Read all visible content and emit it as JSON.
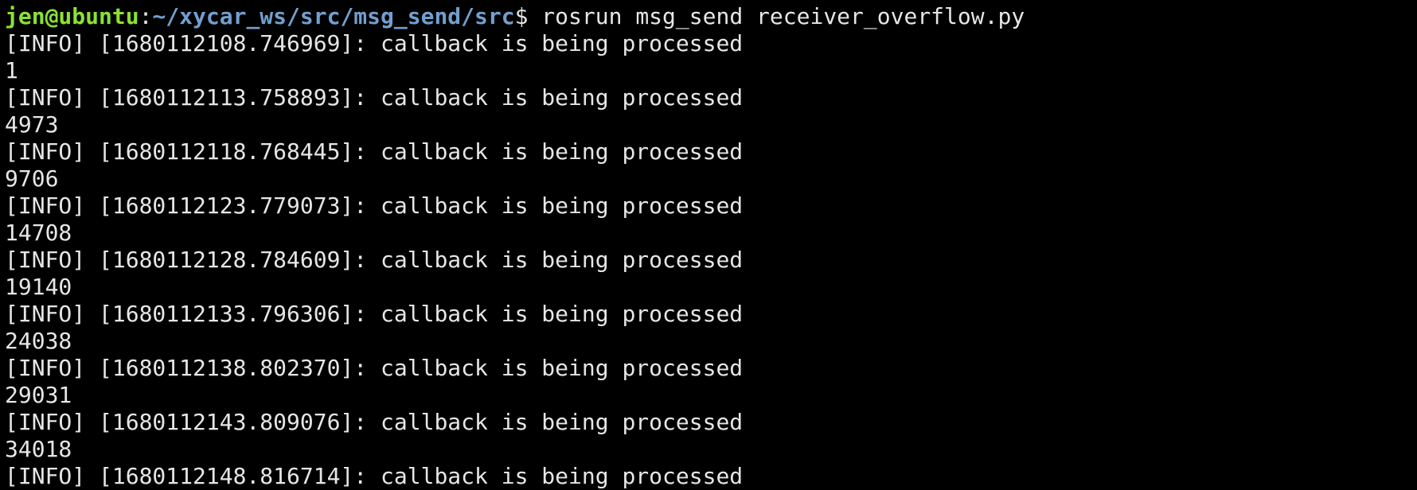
{
  "terminal": {
    "prompt": {
      "user_host": "jen@ubuntu",
      "separator": ":",
      "path": "~/xycar_ws/src/msg_send/src",
      "symbol": "$",
      "command": " rosrun msg_send receiver_overflow.py"
    },
    "output": [
      "[INFO] [1680112108.746969]: callback is being processed",
      "1",
      "[INFO] [1680112113.758893]: callback is being processed",
      "4973",
      "[INFO] [1680112118.768445]: callback is being processed",
      "9706",
      "[INFO] [1680112123.779073]: callback is being processed",
      "14708",
      "[INFO] [1680112128.784609]: callback is being processed",
      "19140",
      "[INFO] [1680112133.796306]: callback is being processed",
      "24038",
      "[INFO] [1680112138.802370]: callback is being processed",
      "29031",
      "[INFO] [1680112143.809076]: callback is being processed",
      "34018",
      "[INFO] [1680112148.816714]: callback is being processed"
    ],
    "colors": {
      "background": "#000000",
      "text": "#e6e6e6",
      "user_host": "#8ae234",
      "path": "#729fcf"
    }
  }
}
